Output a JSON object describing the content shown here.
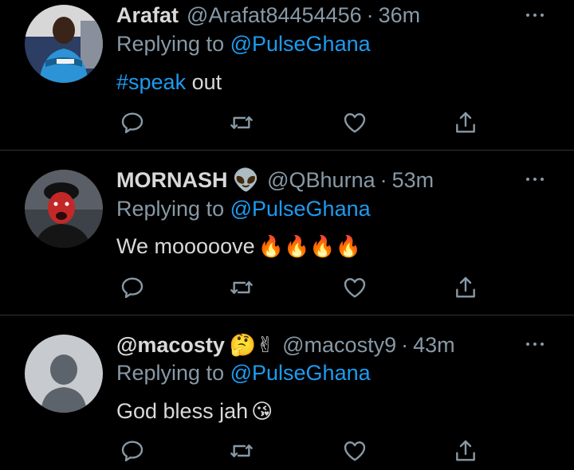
{
  "colors": {
    "background": "#000000",
    "text": "#d9d9d9",
    "muted": "#8899a6",
    "link": "#1d9bf0",
    "divider": "#2f3336"
  },
  "tweets": [
    {
      "name": "Arafat",
      "name_emoji": "",
      "handle": "@Arafat84454456",
      "separator": "·",
      "time": "36m",
      "replying_to_prefix": "Replying to",
      "replying_to": "@PulseGhana",
      "body_hashtag": "#speak",
      "body_text": " out",
      "body_emoji": "",
      "avatar": "profile-photo-blue-shirt",
      "actions": [
        "reply-icon",
        "retweet-icon",
        "like-icon",
        "share-icon"
      ]
    },
    {
      "name": "MORNASH",
      "name_emoji": "👽",
      "handle": "@QBhurna",
      "separator": "·",
      "time": "53m",
      "replying_to_prefix": "Replying to",
      "replying_to": "@PulseGhana",
      "body_hashtag": "",
      "body_text": "We mooooove",
      "body_emoji": "🔥🔥🔥🔥",
      "avatar": "profile-photo-red-face",
      "actions": [
        "reply-icon",
        "retweet-icon",
        "like-icon",
        "share-icon"
      ]
    },
    {
      "name": "@macosty",
      "name_emoji": "🤔✌",
      "handle": "@macosty9",
      "separator": "·",
      "time": "43m",
      "replying_to_prefix": "Replying to",
      "replying_to": "@PulseGhana",
      "body_hashtag": "",
      "body_text": "God bless jah",
      "body_emoji": "😘",
      "avatar": "default-avatar",
      "actions": [
        "reply-icon",
        "retweet-icon",
        "like-icon",
        "share-icon"
      ]
    }
  ]
}
